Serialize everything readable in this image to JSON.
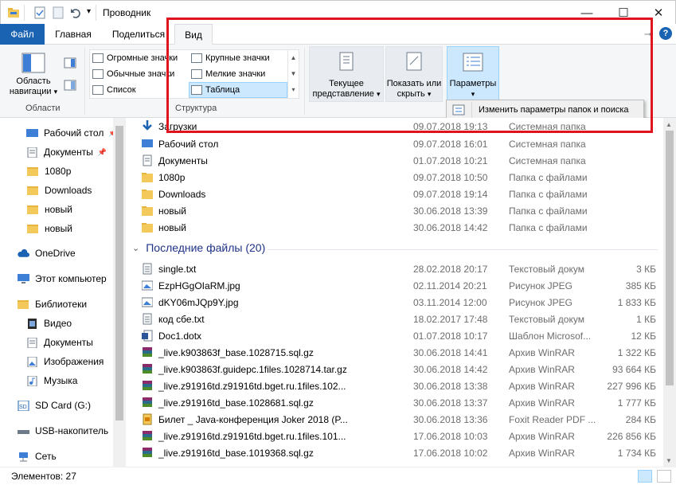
{
  "window": {
    "title": "Проводник",
    "minimize": "—",
    "maximize": "☐",
    "close": "✕"
  },
  "tabs": {
    "file": "Файл",
    "home": "Главная",
    "share": "Поделиться",
    "view": "Вид",
    "help": "?",
    "pin": "⭢"
  },
  "ribbon": {
    "nav_pane": "Область навигации",
    "nav_pane_arrow": "▾",
    "group_panes": "Области",
    "layouts": [
      {
        "label": "Огромные значки"
      },
      {
        "label": "Крупные значки"
      },
      {
        "label": "Обычные значки"
      },
      {
        "label": "Мелкие значки"
      },
      {
        "label": "Список"
      },
      {
        "label": "Таблица",
        "selected": true
      }
    ],
    "group_layout": "Структура",
    "current_view": "Текущее представление",
    "current_view_arrow": "▾",
    "show_hide": "Показать или скрыть",
    "show_hide_arrow": "▾",
    "options": "Параметры",
    "options_arrow": "▾"
  },
  "options_menu": {
    "item": "Изменить параметры папок и поиска"
  },
  "nav": {
    "items": [
      {
        "label": "Рабочий стол",
        "pinned": true
      },
      {
        "label": "Документы",
        "pinned": true
      },
      {
        "label": "1080p"
      },
      {
        "label": "Downloads"
      },
      {
        "label": "новый"
      },
      {
        "label": "новый"
      },
      {
        "label": "OneDrive"
      },
      {
        "label": "Этот компьютер"
      },
      {
        "label": "Библиотеки"
      },
      {
        "label": "Видео"
      },
      {
        "label": "Документы"
      },
      {
        "label": "Изображения"
      },
      {
        "label": "Музыка"
      },
      {
        "label": "SD Card (G:)"
      },
      {
        "label": "USB-накопитель"
      },
      {
        "label": "Сеть"
      }
    ],
    "pin_glyph": "📌"
  },
  "frequent": [
    {
      "name": "Загрузки",
      "date": "09.07.2018 19:13",
      "type": "Системная папка"
    },
    {
      "name": "Рабочий стол",
      "date": "09.07.2018 16:01",
      "type": "Системная папка"
    },
    {
      "name": "Документы",
      "date": "01.07.2018 10:21",
      "type": "Системная папка"
    },
    {
      "name": "1080p",
      "date": "09.07.2018 10:50",
      "type": "Папка с файлами"
    },
    {
      "name": "Downloads",
      "date": "09.07.2018 19:14",
      "type": "Папка с файлами"
    },
    {
      "name": "новый",
      "date": "30.06.2018 13:39",
      "type": "Папка с файлами"
    },
    {
      "name": "новый",
      "date": "30.06.2018 14:42",
      "type": "Папка с файлами"
    }
  ],
  "recent_header": "Последние файлы (20)",
  "recent": [
    {
      "name": "single.txt",
      "date": "28.02.2018 20:17",
      "type": "Текстовый докум",
      "size": "3 КБ",
      "icon": "txt"
    },
    {
      "name": "EzpHGgOIaRM.jpg",
      "date": "02.11.2014 20:21",
      "type": "Рисунок JPEG",
      "size": "385 КБ",
      "icon": "jpg"
    },
    {
      "name": "dKY06mJQp9Y.jpg",
      "date": "03.11.2014 12:00",
      "type": "Рисунок JPEG",
      "size": "1 833 КБ",
      "icon": "jpg"
    },
    {
      "name": "код сбе.txt",
      "date": "18.02.2017 17:48",
      "type": "Текстовый докум",
      "size": "1 КБ",
      "icon": "txt"
    },
    {
      "name": "Doc1.dotx",
      "date": "01.07.2018 10:17",
      "type": "Шаблон Microsof...",
      "size": "12 КБ",
      "icon": "word"
    },
    {
      "name": "_live.k903863f_base.1028715.sql.gz",
      "date": "30.06.2018 14:41",
      "type": "Архив WinRAR",
      "size": "1 322 КБ",
      "icon": "rar"
    },
    {
      "name": "_live.k903863f.guidepc.1files.1028714.tar.gz",
      "date": "30.06.2018 14:42",
      "type": "Архив WinRAR",
      "size": "93 664 КБ",
      "icon": "rar"
    },
    {
      "name": "_live.z91916td.z91916td.bget.ru.1files.102...",
      "date": "30.06.2018 13:38",
      "type": "Архив WinRAR",
      "size": "227 996 КБ",
      "icon": "rar"
    },
    {
      "name": "_live.z91916td_base.1028681.sql.gz",
      "date": "30.06.2018 13:37",
      "type": "Архив WinRAR",
      "size": "1 777 КБ",
      "icon": "rar"
    },
    {
      "name": "Билет _ Java-конференция Joker 2018 (P...",
      "date": "30.06.2018 13:36",
      "type": "Foxit Reader PDF ...",
      "size": "284 КБ",
      "icon": "pdf"
    },
    {
      "name": "_live.z91916td.z91916td.bget.ru.1files.101...",
      "date": "17.06.2018 10:03",
      "type": "Архив WinRAR",
      "size": "226 856 КБ",
      "icon": "rar"
    },
    {
      "name": "_live.z91916td_base.1019368.sql.gz",
      "date": "17.06.2018 10:02",
      "type": "Архив WinRAR",
      "size": "1 734 КБ",
      "icon": "rar"
    }
  ],
  "status": {
    "items": "Элементов: 27"
  },
  "colors": {
    "accent": "#1a63b2",
    "highlight": "#e0141e",
    "selected": "#cce8ff"
  }
}
